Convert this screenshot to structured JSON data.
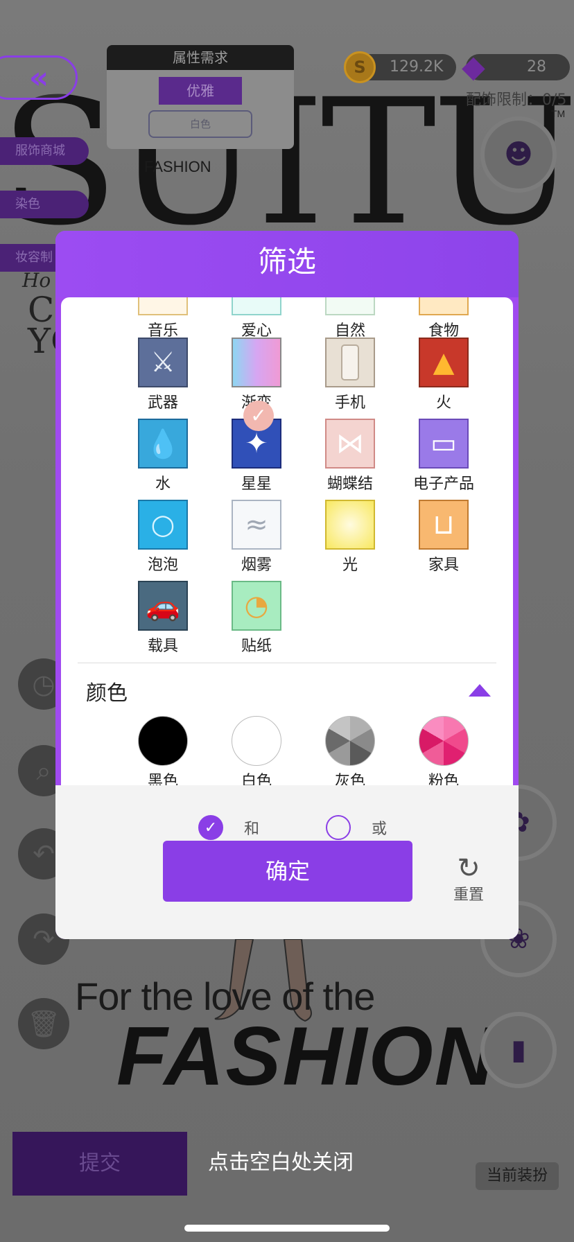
{
  "background": {
    "big_letters": "SUITU",
    "fashion_small": "FASHION",
    "tm": "TM",
    "ho_text": "Ho",
    "yo_text": "C\nYO",
    "love_text": "For the love of the",
    "fashion_big": "FASHION"
  },
  "attribute_panel": {
    "title": "属性需求",
    "tag": "优雅",
    "sub_tag": "白色"
  },
  "currency": {
    "coins": "129.2K",
    "gems": "28",
    "accessory_limit": "配饰限制：0/5"
  },
  "side_tabs": [
    "服饰商城",
    "染色",
    "妆容制"
  ],
  "bottom": {
    "submit_label": "提交",
    "close_hint": "点击空白处关闭",
    "current_outfit_label": "当前装扮"
  },
  "modal": {
    "title": "筛选",
    "top_partial_row": [
      "音乐",
      "爱心",
      "自然",
      "食物"
    ],
    "categories": [
      {
        "label": "武器",
        "icon": "crossed-swords-icon"
      },
      {
        "label": "渐变",
        "icon": "gradient-icon"
      },
      {
        "label": "手机",
        "icon": "phone-icon"
      },
      {
        "label": "火",
        "icon": "fire-icon"
      },
      {
        "label": "水",
        "icon": "water-icon"
      },
      {
        "label": "星星",
        "icon": "stars-icon",
        "selected": true
      },
      {
        "label": "蝴蝶结",
        "icon": "bow-icon"
      },
      {
        "label": "电子产品",
        "icon": "electronics-icon"
      },
      {
        "label": "泡泡",
        "icon": "bubbles-icon"
      },
      {
        "label": "烟雾",
        "icon": "smoke-icon"
      },
      {
        "label": "光",
        "icon": "light-icon"
      },
      {
        "label": "家具",
        "icon": "furniture-icon"
      },
      {
        "label": "载具",
        "icon": "vehicle-icon"
      },
      {
        "label": "贴纸",
        "icon": "sticker-icon"
      }
    ],
    "color_section_title": "颜色",
    "colors": [
      {
        "label": "黑色",
        "color": "#000000"
      },
      {
        "label": "白色",
        "color": "#ffffff"
      },
      {
        "label": "灰色",
        "color": "#8a8a8a"
      },
      {
        "label": "粉色",
        "color": "#f0407a"
      }
    ],
    "logic_options": {
      "and_label": "和",
      "or_label": "或",
      "selected": "和"
    },
    "confirm_label": "确定",
    "reset_label": "重置"
  },
  "colors": {
    "accent_purple": "#8a3ee6",
    "header_purple": "#9c4cf2"
  }
}
